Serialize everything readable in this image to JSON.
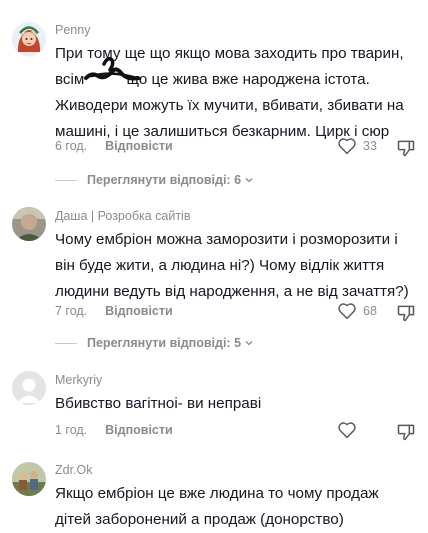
{
  "comments": [
    {
      "author": "Penny",
      "text": "При тому ще що якщо мова заходить про тварин,\nвсім          що це жива вже народжена істота.\nЖиводери можуть їх мучити, вбивати, збивати на\nмашині, і це залишиться безкарним. Цирк і сюр",
      "time": "6 год.",
      "reply": "Відповісти",
      "likes": "33",
      "view_replies": "Переглянути відповіді: 6"
    },
    {
      "author": "Даша | Розробка сайтів",
      "text": "Чому ембріон можна заморозити і розморозити і\nвін буде жити, а людина ні?) Чому відлік життя\nлюдини ведуть від народження, а не від зачаття?)",
      "time": "7 год.",
      "reply": "Відповісти",
      "likes": "68",
      "view_replies": "Переглянути відповіді: 5"
    },
    {
      "author": "Merkyriy",
      "text": "Вбивство вагітноі- ви неправі",
      "time": "1 год.",
      "reply": "Відповісти",
      "likes": ""
    },
    {
      "author": "Zdr.Ok",
      "text": "Якщо ембріон це вже людина то чому продаж\nдітей заборонений а продаж (донорство)"
    }
  ],
  "icons": {
    "like": "heart-outline-icon",
    "dislike": "thumbs-down-outline-icon",
    "chevron": "chevron-down-icon"
  },
  "colors": {
    "text": "#161823",
    "muted": "#8a8b91",
    "scribble": "#111111"
  }
}
